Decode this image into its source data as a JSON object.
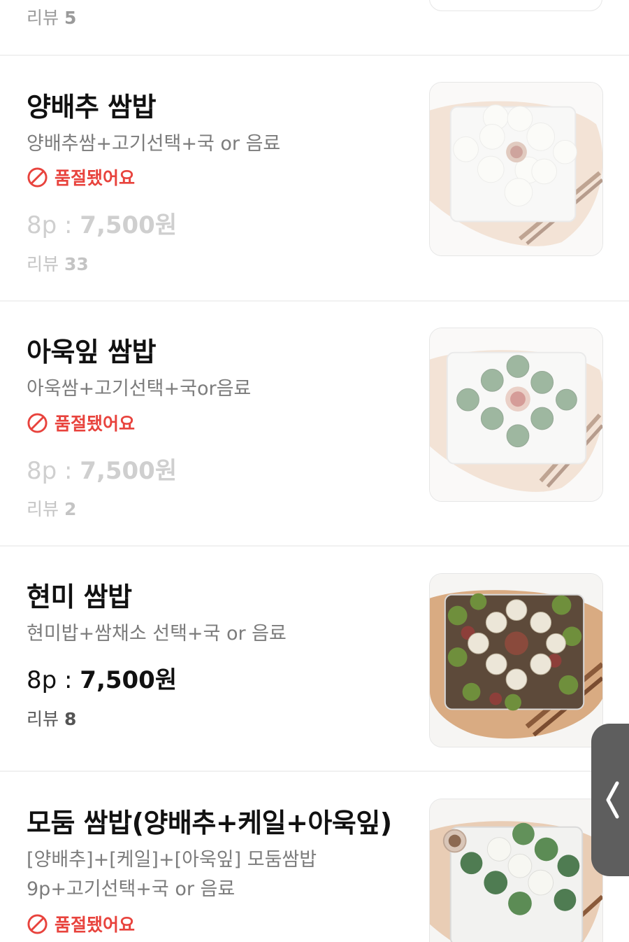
{
  "top": {
    "review_label": "리뷰",
    "review_count": "5"
  },
  "items": [
    {
      "name": "양배추 쌈밥",
      "desc": [
        "양배추쌈+고기선택+국 or 음료"
      ],
      "soldout": "품절됐어요",
      "price_prefix": "8p : ",
      "price_amount": "7,500원",
      "review_label": "리뷰",
      "review_count": "33",
      "image": "cabbage-ssambap-photo"
    },
    {
      "name": "아욱잎 쌈밥",
      "desc": [
        "아욱쌈+고기선택+국or음료"
      ],
      "soldout": "품절됐어요",
      "price_prefix": "8p : ",
      "price_amount": "7,500원",
      "review_label": "리뷰",
      "review_count": "2",
      "image": "mallow-leaf-ssambap-photo"
    },
    {
      "name": "현미 쌈밥",
      "desc": [
        "현미밥+쌈채소 선택+국 or 음료"
      ],
      "soldout": "",
      "price_prefix": "8p : ",
      "price_amount": "7,500원",
      "review_label": "리뷰",
      "review_count": "8",
      "image": "brown-rice-ssambap-photo"
    },
    {
      "name": "모둠 쌈밥(양배추+케일+아욱잎)",
      "desc": [
        "[양배추]+[케일]+[아욱잎] 모둠쌈밥",
        " 9p+고기선택+국 or 음료"
      ],
      "soldout": "품절됐어요",
      "image": "assorted-ssambap-photo"
    }
  ],
  "colors": {
    "soldout": "#e8433d",
    "muted": "#cfcfcf",
    "divider": "#f1f1f1",
    "side_handle": "#5e5e5e"
  },
  "icons": {
    "soldout": "no-entry-icon",
    "side_handle": "chevron-left-icon"
  }
}
